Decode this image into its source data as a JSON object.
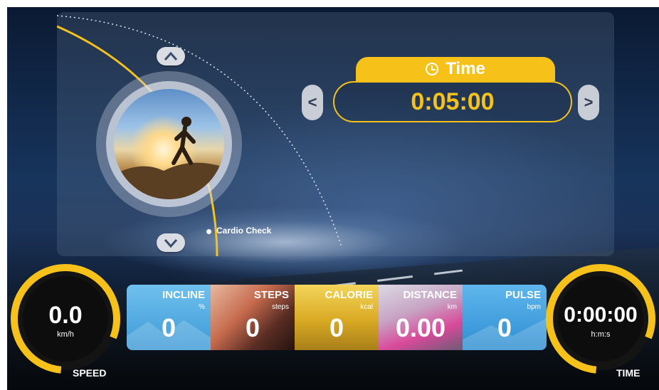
{
  "program": {
    "label": "Cardio Check",
    "up_icon": "chevron-up-icon",
    "down_icon": "chevron-down-icon"
  },
  "setting": {
    "title": "Time",
    "value": "0:05:00",
    "prev": "<",
    "next": ">"
  },
  "speed": {
    "value": "0.0",
    "unit": "km/h",
    "label": "SPEED"
  },
  "time_gauge": {
    "value": "0:00:00",
    "unit": "h:m:s",
    "label": "TIME"
  },
  "tiles": [
    {
      "title": "INCLINE",
      "unit": "%",
      "value": "0"
    },
    {
      "title": "STEPS",
      "unit": "steps",
      "value": "0"
    },
    {
      "title": "CALORIE",
      "unit": "kcal",
      "value": "0"
    },
    {
      "title": "DISTANCE",
      "unit": "km",
      "value": "0.00"
    },
    {
      "title": "PULSE",
      "unit": "bpm",
      "value": "0"
    }
  ],
  "colors": {
    "accent": "#f6c21a",
    "tile_blue": "#4aa7e0",
    "panel": "#8a9ab4"
  }
}
